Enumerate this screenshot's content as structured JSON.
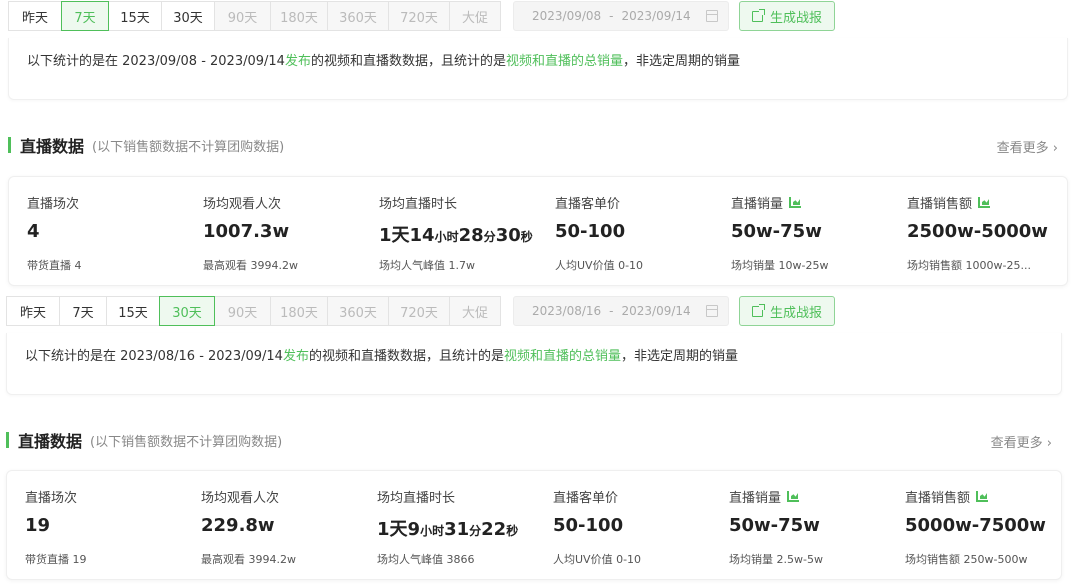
{
  "panels": [
    {
      "range_buttons": [
        {
          "label": "昨天",
          "state": "normal"
        },
        {
          "label": "7天",
          "state": "active"
        },
        {
          "label": "15天",
          "state": "normal"
        },
        {
          "label": "30天",
          "state": "normal"
        },
        {
          "label": "90天",
          "state": "disabled"
        },
        {
          "label": "180天",
          "state": "disabled"
        },
        {
          "label": "360天",
          "state": "disabled"
        },
        {
          "label": "720天",
          "state": "disabled"
        },
        {
          "label": "大促",
          "state": "disabled"
        }
      ],
      "date_start": "2023/09/08",
      "date_sep": "-",
      "date_end": "2023/09/14",
      "report_button": "生成战报",
      "notice": {
        "prefix": "以下统计的是在 2023/09/08 - 2023/09/14 ",
        "link1": "发布",
        "middle": "的视频和直播数数据，且统计的是",
        "link2": "视频和直播的总销量",
        "suffix": "，非选定周期的销量"
      },
      "section_title": "直播数据",
      "section_sub": "(以下销售额数据不计算团购数据)",
      "more_link": "查看更多 ›",
      "metrics": [
        {
          "label": "直播场次",
          "value": "4",
          "sub": "带货直播 4",
          "has_chart_icon": false
        },
        {
          "label": "场均观看人次",
          "value": "1007.3w",
          "sub": "最高观看 3994.2w",
          "has_chart_icon": false
        },
        {
          "label": "场均直播时长",
          "duration": {
            "d": "1",
            "du": "天",
            "h": "14",
            "hu": "小时",
            "m": "28",
            "mu": "分",
            "s": "30",
            "su": "秒"
          },
          "sub": "场均人气峰值 1.7w",
          "has_chart_icon": false
        },
        {
          "label": "直播客单价",
          "value": "50-100",
          "sub": "人均UV价值 0-10",
          "has_chart_icon": false
        },
        {
          "label": "直播销量",
          "value": "50w-75w",
          "sub": "场均销量 10w-25w",
          "has_chart_icon": true
        },
        {
          "label": "直播销售额",
          "value": "2500w-5000w",
          "sub": "场均销售额 1000w-25...",
          "has_chart_icon": true
        }
      ]
    },
    {
      "range_buttons": [
        {
          "label": "昨天",
          "state": "normal"
        },
        {
          "label": "7天",
          "state": "normal"
        },
        {
          "label": "15天",
          "state": "normal"
        },
        {
          "label": "30天",
          "state": "active"
        },
        {
          "label": "90天",
          "state": "disabled"
        },
        {
          "label": "180天",
          "state": "disabled"
        },
        {
          "label": "360天",
          "state": "disabled"
        },
        {
          "label": "720天",
          "state": "disabled"
        },
        {
          "label": "大促",
          "state": "disabled"
        }
      ],
      "date_start": "2023/08/16",
      "date_sep": "-",
      "date_end": "2023/09/14",
      "report_button": "生成战报",
      "notice": {
        "prefix": "以下统计的是在 2023/08/16 - 2023/09/14 ",
        "link1": "发布",
        "middle": "的视频和直播数数据，且统计的是",
        "link2": "视频和直播的总销量",
        "suffix": "，非选定周期的销量"
      },
      "section_title": "直播数据",
      "section_sub": "(以下销售额数据不计算团购数据)",
      "more_link": "查看更多 ›",
      "metrics": [
        {
          "label": "直播场次",
          "value": "19",
          "sub": "带货直播 19",
          "has_chart_icon": false
        },
        {
          "label": "场均观看人次",
          "value": "229.8w",
          "sub": "最高观看 3994.2w",
          "has_chart_icon": false
        },
        {
          "label": "场均直播时长",
          "duration": {
            "d": "1",
            "du": "天",
            "h": "9",
            "hu": "小时",
            "m": "31",
            "mu": "分",
            "s": "22",
            "su": "秒"
          },
          "sub": "场均人气峰值 3866",
          "has_chart_icon": false
        },
        {
          "label": "直播客单价",
          "value": "50-100",
          "sub": "人均UV价值 0-10",
          "has_chart_icon": false
        },
        {
          "label": "直播销量",
          "value": "50w-75w",
          "sub": "场均销量 2.5w-5w",
          "has_chart_icon": true
        },
        {
          "label": "直播销售额",
          "value": "5000w-7500w",
          "sub": "场均销售额 250w-500w",
          "has_chart_icon": true
        }
      ]
    }
  ],
  "colors": {
    "accent": "#4fbf5a",
    "active_bg": "#eef9ef"
  }
}
